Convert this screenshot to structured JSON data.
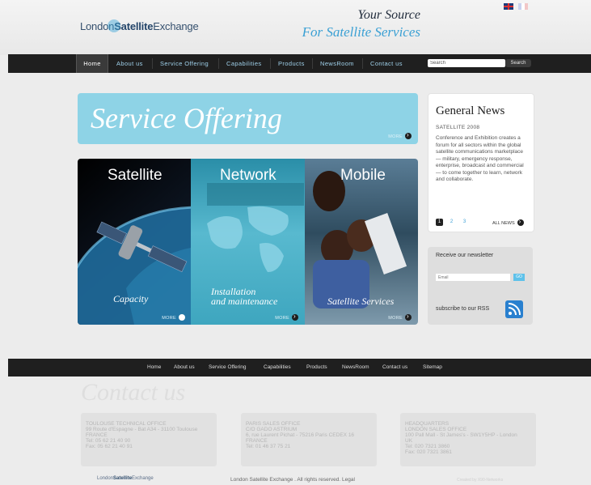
{
  "header": {
    "logo": {
      "part1": "London",
      "part2": "Satellite",
      "part3": "Exchange"
    },
    "tagline1": "Your Source",
    "tagline2": "For Satellite Services",
    "languages": [
      "uk-flag-icon",
      "fr-flag-icon"
    ]
  },
  "nav": {
    "items": [
      "Home",
      "About us",
      "Service Offering",
      "Capabilities",
      "Products",
      "NewsRoom",
      "Contact us"
    ],
    "active": "Home",
    "search_value": "Search",
    "search_button": "Search"
  },
  "hero": {
    "title": "Service Offering",
    "more": "MORE"
  },
  "panels": [
    {
      "title": "Satellite",
      "caption": "Capacity",
      "more": "MORE"
    },
    {
      "title": "Network",
      "caption_line1": "Installation",
      "caption_line2": "and maintenance",
      "more": "MORE"
    },
    {
      "title": "Mobile",
      "caption": "Satellite Services",
      "more": "MORE"
    }
  ],
  "news": {
    "title": "General News",
    "subtitle": "SATELLITE 2008",
    "body": "Conference and Exhibition creates a forum for all sectors within the global satellite communications marketplace — military, emergency response, enterprise, broadcast and commercial — to come together to learn, network and collaborate.",
    "pages": [
      "1",
      "2",
      "3"
    ],
    "current_page": "1",
    "all_news": "ALL NEWS"
  },
  "newsletter": {
    "title": "Receive our newsletter",
    "email_placeholder": "Email",
    "go": "GO",
    "rss": "subscribe to our RSS",
    "rss_icon": "rss-icon"
  },
  "footer_nav": [
    "Home",
    "About us",
    "Service Offering",
    "Capabilities",
    "Products",
    "NewsRoom",
    "Contact us",
    "Sitemap"
  ],
  "contact": {
    "title": "Contact us",
    "offices": [
      {
        "lines": [
          "TOULOUSE TECHNICAL OFFICE",
          "99 Route d'Espagne - Bat A34 - 31100 Toulouse",
          "FRANCE",
          "Tel: 05 62 21 40 90",
          "Fax: 05 62 21 40 91"
        ]
      },
      {
        "lines": [
          "PARIS SALES OFFICE",
          "C/O GADO ASTRIUM",
          "6, rue Laurent Pichat - 75216 Paris CEDEX 16",
          "FRANCE",
          "Tel: 01 46 37 75 21"
        ]
      },
      {
        "lines": [
          "HEADQUARTERS",
          "LONDON SALES OFFICE",
          "100 Pall Mall - St James's - SW1Y5HP - London",
          "UK",
          "Tel: 020 7321 3860",
          "Fax: 020 7321 3861"
        ]
      }
    ]
  },
  "footer": {
    "logo": {
      "part1": "London",
      "part2": "Satellite",
      "part3": "Exchange"
    },
    "copyright": "London Satellite Exchange . All rights reserved. Legal",
    "credit": "Created by X90-Networks"
  },
  "colors": {
    "nav_bg": "#1f1f1f",
    "accent": "#3aa0d4",
    "hero_bg": "#8ed3e6",
    "page_bg": "#ececec"
  }
}
